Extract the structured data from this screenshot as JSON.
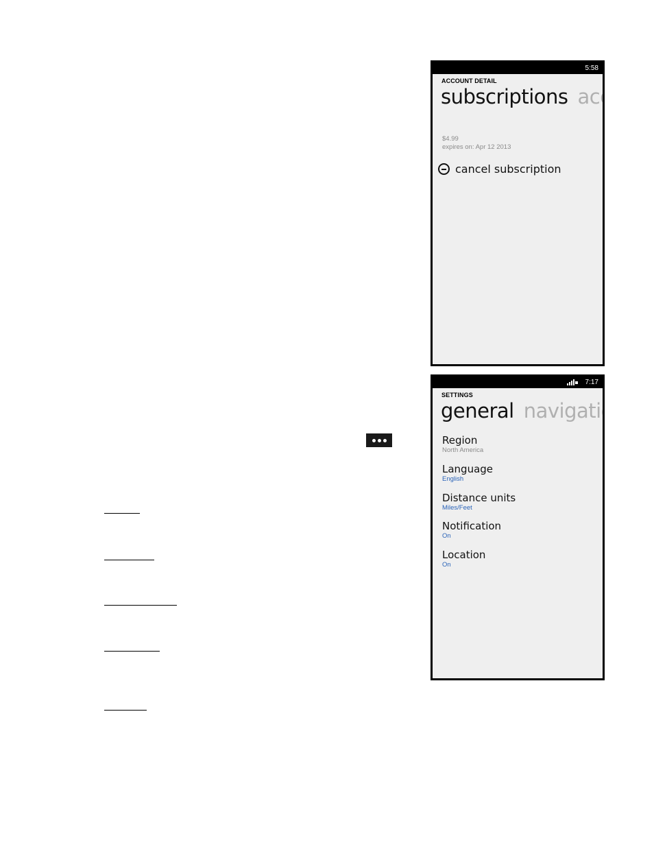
{
  "account_screen": {
    "status_time": "5:58",
    "page_label": "ACCOUNT DETAIL",
    "active_pivot": "subscriptions",
    "next_pivot": "acc",
    "price": "$4.99",
    "expires": "expires on: Apr 12 2013",
    "cancel_label": "cancel subscription"
  },
  "settings_screen": {
    "status_time": "7:17",
    "page_label": "SETTINGS",
    "active_pivot": "general",
    "next_pivot": "navigatio",
    "items": [
      {
        "name": "Region",
        "value": "North America",
        "value_color": "#8a8a8a"
      },
      {
        "name": "Language",
        "value": "English",
        "value_color": "#2a63b8"
      },
      {
        "name": "Distance units",
        "value": "Miles/Feet",
        "value_color": "#2a63b8"
      },
      {
        "name": "Notification",
        "value": "On",
        "value_color": "#2a63b8"
      },
      {
        "name": "Location",
        "value": "On",
        "value_color": "#2a63b8"
      }
    ]
  },
  "icons": {
    "menu": "more-options-icon",
    "cancel": "minus-circle-icon",
    "signal": "signal-icon"
  },
  "colors": {
    "accent": "#2a63b8",
    "screen_bg": "#efefef",
    "status_bar": "#000000"
  }
}
